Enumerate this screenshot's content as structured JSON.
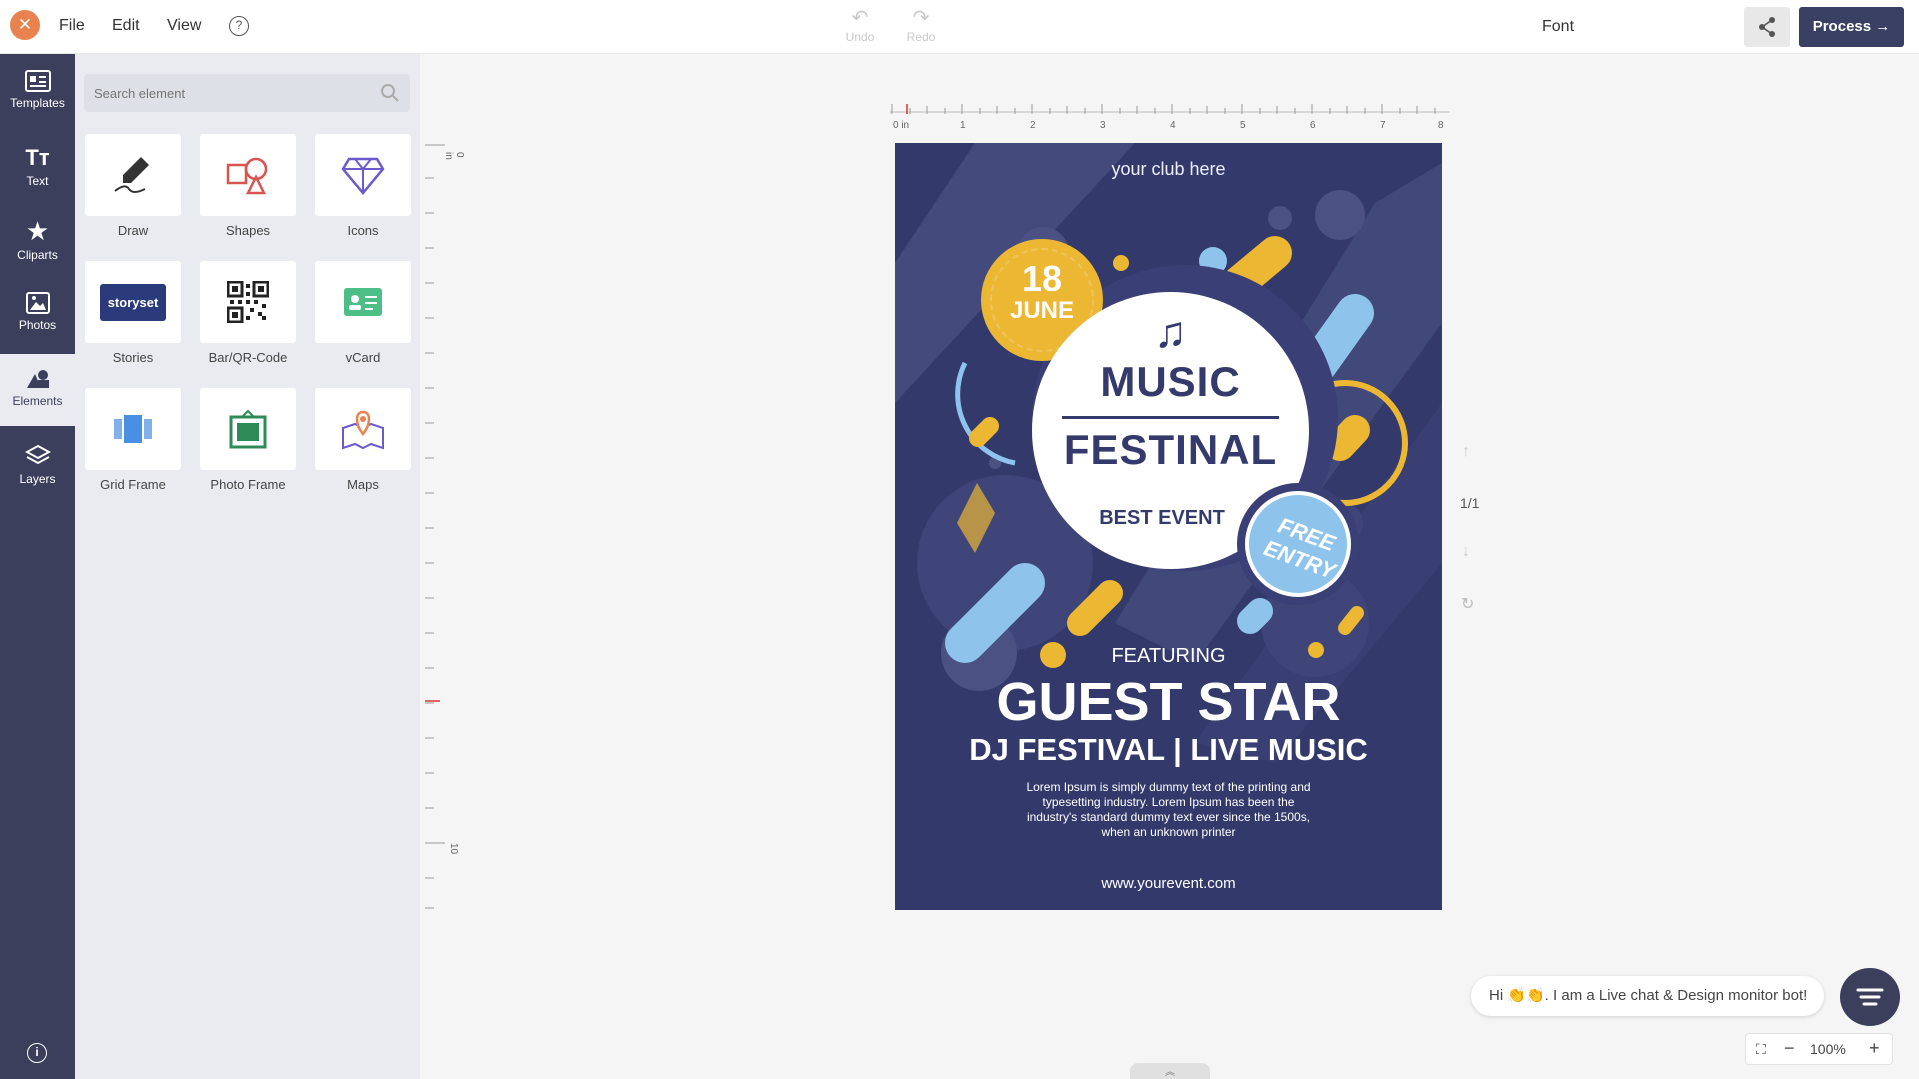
{
  "header": {
    "close_icon": "close-icon",
    "menu": [
      "File",
      "Edit",
      "View"
    ],
    "help_icon": "question-icon",
    "undo_label": "Undo",
    "redo_label": "Redo",
    "font_label": "Font",
    "share_icon": "share-icon",
    "process_label": "Process"
  },
  "leftnav": {
    "items": [
      {
        "label": "Templates",
        "icon": "templates-icon"
      },
      {
        "label": "Text",
        "icon": "text-icon"
      },
      {
        "label": "Cliparts",
        "icon": "star-icon"
      },
      {
        "label": "Photos",
        "icon": "photos-icon"
      },
      {
        "label": "Elements",
        "icon": "elements-icon"
      },
      {
        "label": "Layers",
        "icon": "layers-icon"
      }
    ],
    "active": "Elements"
  },
  "panel": {
    "search_placeholder": "Search element",
    "tiles": [
      {
        "label": "Draw",
        "icon": "pen-icon"
      },
      {
        "label": "Shapes",
        "icon": "shapes-icon"
      },
      {
        "label": "Icons",
        "icon": "diamond-icon"
      },
      {
        "label": "Stories",
        "icon": "storyset-logo",
        "logo_text": "storyset"
      },
      {
        "label": "Bar/QR-Code",
        "icon": "qr-code-icon"
      },
      {
        "label": "vCard",
        "icon": "vcard-icon"
      },
      {
        "label": "Grid Frame",
        "icon": "grid-frame-icon"
      },
      {
        "label": "Photo Frame",
        "icon": "photo-frame-icon"
      },
      {
        "label": "Maps",
        "icon": "map-icon"
      }
    ]
  },
  "ruler": {
    "h_labels": [
      "0 in",
      "1",
      "2",
      "3",
      "4",
      "5",
      "6",
      "7",
      "8"
    ],
    "v_labels": [
      "0 in",
      "10"
    ]
  },
  "poster": {
    "club": "your club here",
    "date_day": "18",
    "date_month": "JUNE",
    "note": "♫",
    "title_1": "MUSIC",
    "title_2": "FESTINAL",
    "subtitle": "BEST EVENT",
    "badge_line_1": "FREE",
    "badge_line_2": "ENTRY",
    "featuring": "FEATURING",
    "headline": "GUEST STAR",
    "tagline": "DJ FESTIVAL | LIVE MUSIC",
    "lorem": "Lorem Ipsum is simply dummy text of the printing and typesetting industry. Lorem Ipsum has been the industry's standard dummy text ever since the 1500s, when an unknown printer",
    "website": "www.yourevent.com",
    "colors": {
      "background": "#333a6b",
      "accent_yellow": "#ecb733",
      "accent_blue": "#8ec4ec"
    }
  },
  "page_nav": {
    "count": "1/1"
  },
  "chat": {
    "message": "Hi 👏👏. I am a Live chat & Design monitor bot!"
  },
  "zoom": {
    "value": "100%"
  },
  "colors": {
    "accent_orange": "#e8834f",
    "nav_bg": "#3b3f5b",
    "process_bg": "#394063"
  }
}
